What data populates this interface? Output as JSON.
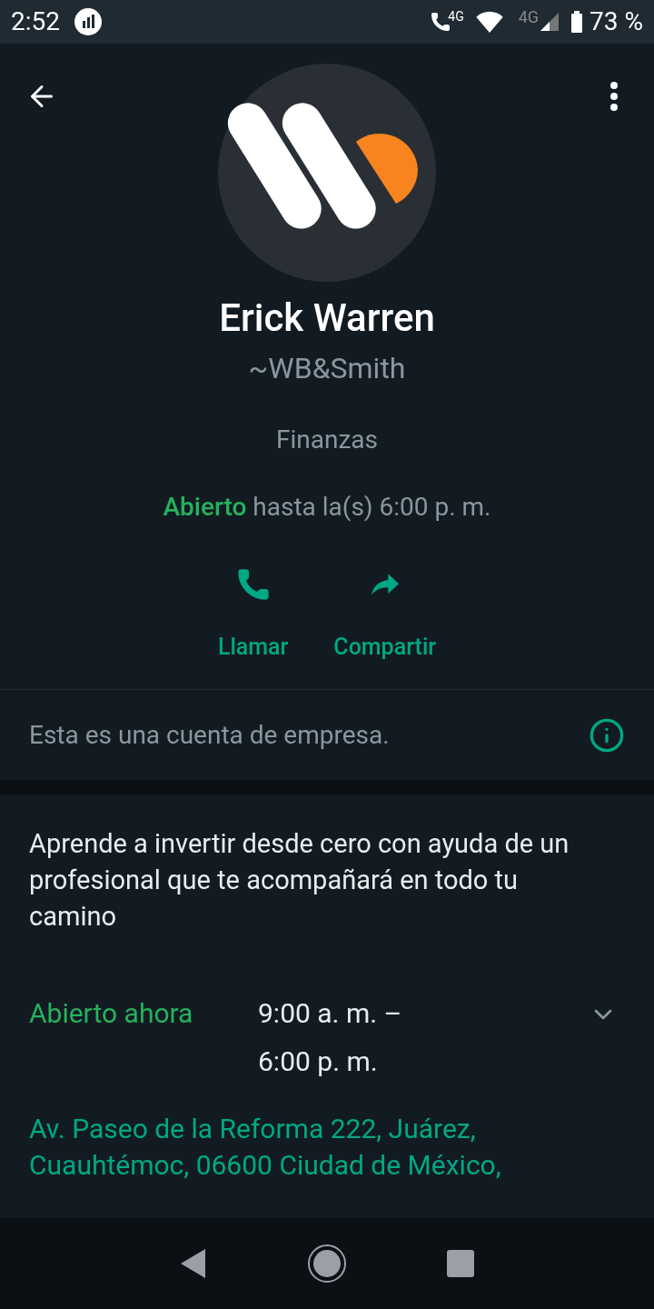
{
  "status_bar": {
    "time": "2:52",
    "network_label": "4G",
    "network_label_2": "4G",
    "battery": "73 %"
  },
  "profile": {
    "name": "Erick Warren",
    "handle": "~WB&Smith",
    "category": "Finanzas",
    "open_status": "Abierto",
    "open_until": "hasta la(s) 6:00 p. m."
  },
  "actions": [
    {
      "kind": "call",
      "label": "Llamar"
    },
    {
      "kind": "share",
      "label": "Compartir"
    }
  ],
  "business_notice": "Esta es una cuenta de empresa.",
  "description": "Aprende a invertir desde cero con ayuda de un profesional que te acompañará en todo tu camino",
  "hours": {
    "status": "Abierto ahora",
    "range_line_1": "9:00 a. m. –",
    "range_line_2": "6:00 p. m.",
    "expanded": false
  },
  "address_lines": [
    "Av. Paseo de la Reforma 222, Juárez,",
    "Cuauhtémoc, 06600 Ciudad de México,"
  ]
}
